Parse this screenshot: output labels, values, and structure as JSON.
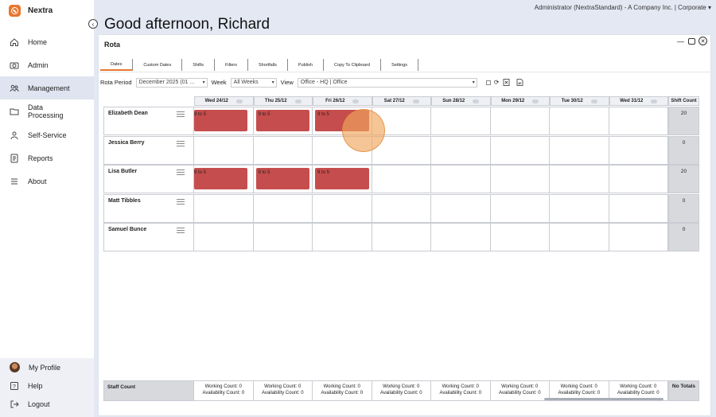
{
  "brand": {
    "name": "Nextra"
  },
  "sidebar": {
    "items": [
      {
        "label": "Home",
        "icon": "home-icon"
      },
      {
        "label": "Admin",
        "icon": "camera-icon"
      },
      {
        "label": "Management",
        "icon": "people-icon",
        "active": true
      },
      {
        "label": "Data Processing",
        "icon": "folder-icon"
      },
      {
        "label": "Self-Service",
        "icon": "person-icon"
      },
      {
        "label": "Reports",
        "icon": "report-icon"
      },
      {
        "label": "About",
        "icon": "menu-icon"
      }
    ],
    "bottom": [
      {
        "label": "My Profile",
        "icon": "avatar"
      },
      {
        "label": "Help",
        "icon": "help-icon"
      },
      {
        "label": "Logout",
        "icon": "logout-icon"
      }
    ]
  },
  "header": {
    "greeting": "Good afternoon, Richard",
    "account": "Administrator (NextraStandard) - A Company Inc. | Corporate"
  },
  "panel": {
    "title": "Rota",
    "tabs": [
      "Dates",
      "Custom Dates",
      "Shifts",
      "Filters",
      "Shortfalls",
      "Publish",
      "Copy To Clipboard",
      "Settings"
    ],
    "filters": {
      "rota_period_label": "Rota Period",
      "rota_period_value": "December 2025 (01 ...",
      "week_label": "Week",
      "week_value": "All Weeks",
      "view_label": "View",
      "view_value": "Office - HQ | Office"
    },
    "columns": [
      "Wed 24/12",
      "Thu 25/12",
      "Fri 26/12",
      "Sat 27/12",
      "Sun 28/12",
      "Mon 29/12",
      "Tue 30/12",
      "Wed 31/12"
    ],
    "shift_count_label": "Shift Count",
    "rows": [
      {
        "name": "Elizabeth Dean",
        "shifts": [
          "9 to 5",
          "9 to 5",
          "9 to 5",
          "",
          "",
          "",
          "",
          ""
        ],
        "count": "20"
      },
      {
        "name": "Jessica Berry",
        "shifts": [
          "",
          "",
          "",
          "",
          "",
          "",
          "",
          ""
        ],
        "count": "0"
      },
      {
        "name": "Lisa Butler",
        "shifts": [
          "9 to 5",
          "9 to 5",
          "9 to 5",
          "",
          "",
          "",
          "",
          ""
        ],
        "count": "20"
      },
      {
        "name": "Matt Tibbles",
        "shifts": [
          "",
          "",
          "",
          "",
          "",
          "",
          "",
          ""
        ],
        "count": "0"
      },
      {
        "name": "Samuel Bunce",
        "shifts": [
          "",
          "",
          "",
          "",
          "",
          "",
          "",
          ""
        ],
        "count": "0"
      }
    ],
    "footer": {
      "label": "Staff Count",
      "working": "Working Count: 0",
      "availability": "Availability Count: 0",
      "totals": "No Totals"
    }
  },
  "colors": {
    "accent": "#e8772e",
    "shift": "#c64d4d",
    "background": "#e4e8f3"
  }
}
